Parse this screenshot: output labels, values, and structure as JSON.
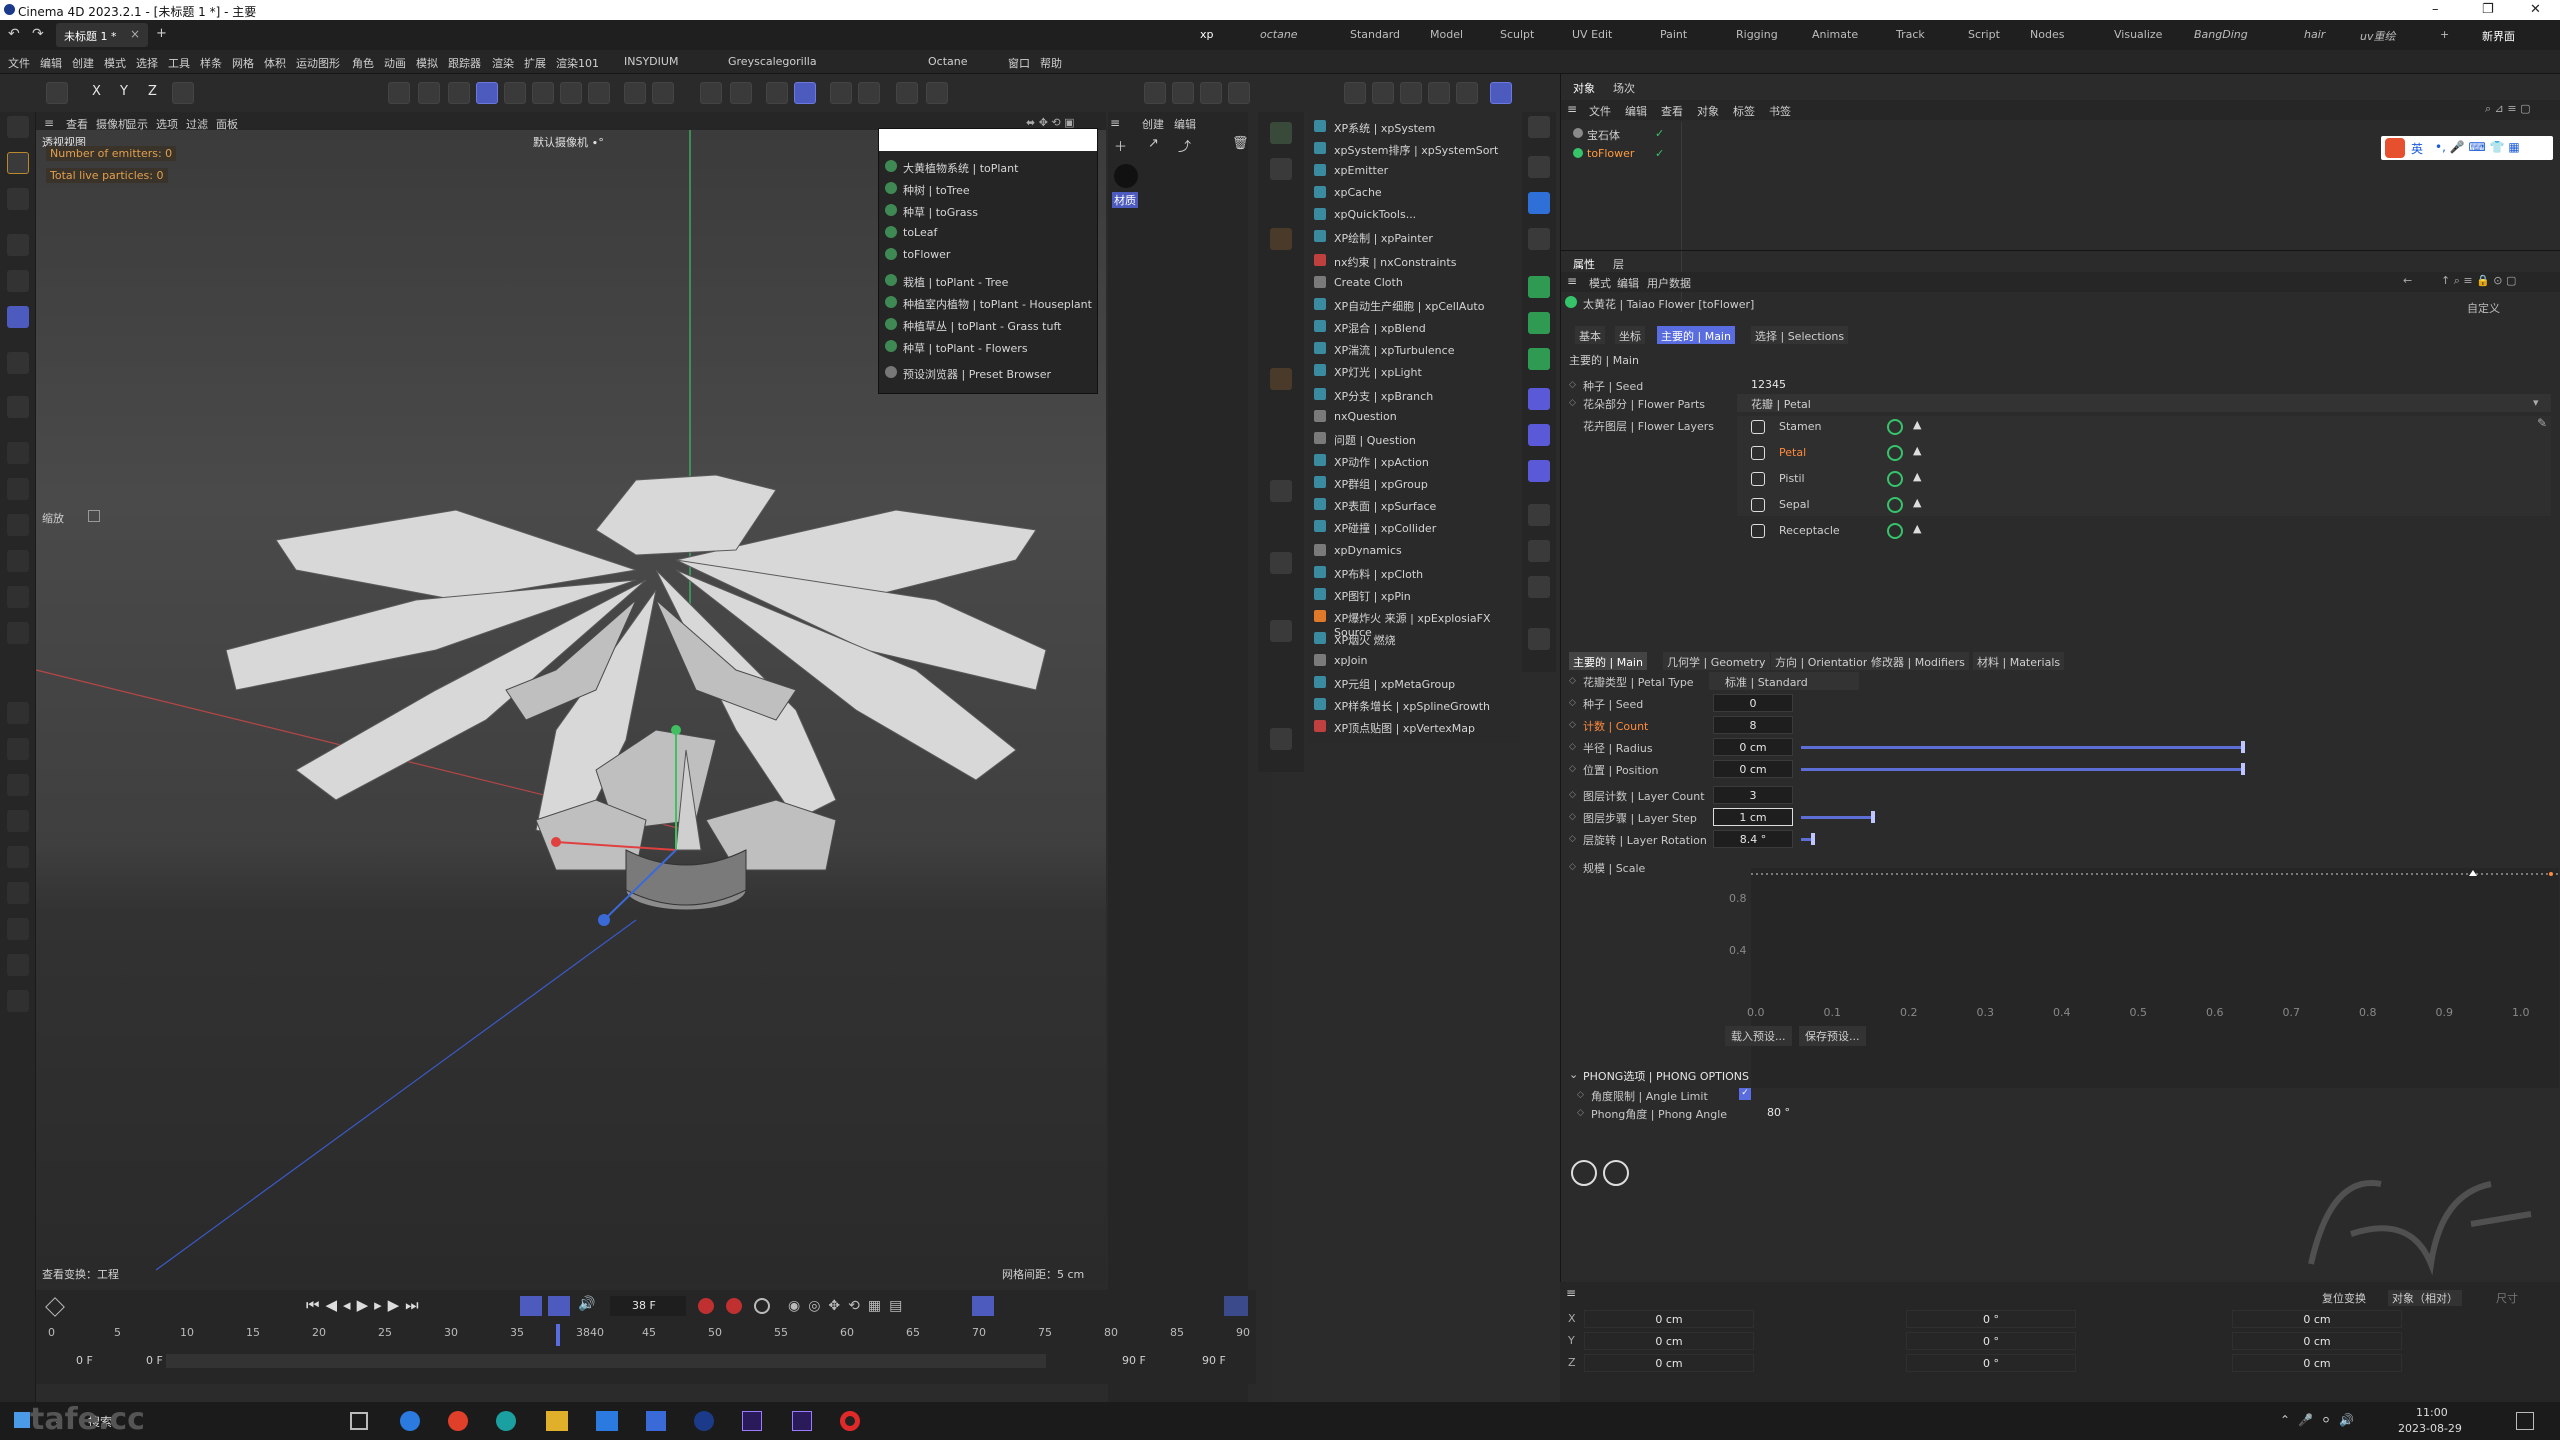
{
  "window": {
    "title": "Cinema 4D 2023.2.1 - [未标题 1 *] - 主要",
    "minimize": "–",
    "maximize": "❐",
    "close": "✕"
  },
  "tabs": {
    "doc": "未标题 1 *",
    "close": "×",
    "add": "+",
    "layouts": [
      "xp",
      "octane",
      "Standard",
      "Model",
      "Sculpt",
      "UV Edit",
      "Paint",
      "Rigging",
      "Animate",
      "Track",
      "Script",
      "Nodes",
      "Visualize",
      "BangDing",
      "hair",
      "uv重绘"
    ],
    "new_interface": "新界面"
  },
  "menus": [
    "文件",
    "编辑",
    "创建",
    "模式",
    "选择",
    "工具",
    "样条",
    "网格",
    "体积",
    "运动图形",
    "角色",
    "动画",
    "模拟",
    "跟踪器",
    "渲染",
    "扩展",
    "渲染101",
    "INSYDIUM",
    "Greyscalegorilla",
    "Octane",
    "窗口",
    "帮助"
  ],
  "toolbar": {
    "x": "X",
    "y": "Y",
    "z": "Z"
  },
  "viewport": {
    "menus": [
      "查看",
      "摄像机",
      "显示",
      "选项",
      "过滤",
      "面板"
    ],
    "label": "透视视图",
    "camera": "默认摄像机 ∙°",
    "emitters": "Number of emitters: 0",
    "particles": "Total live particles: 0",
    "zoom_label": "缩放",
    "footer_left": "查看变换：工程",
    "footer_right": "网格间距：5 cm"
  },
  "popup": {
    "items": [
      "大黄植物系统 | toPlant",
      "种树 | toTree",
      "种草 | toGrass",
      "toLeaf",
      "toFlower",
      "栽植 | toPlant - Tree",
      "种植室内植物 | toPlant - Houseplant",
      "种植草丛 | toPlant - Grass tuft",
      "种草 | toPlant - Flowers",
      "预设浏览器 | Preset Browser"
    ]
  },
  "objstrip": {
    "menus": [
      "创建",
      "编辑"
    ],
    "material": "材质"
  },
  "xplist": {
    "items": [
      "XP系统 | xpSystem",
      "xpSystem排序 | xpSystemSort",
      "xpEmitter",
      "xpCache",
      "xpQuickTools...",
      "XP绘制 | xpPainter",
      "nx约束 | nxConstraints",
      "Create Cloth",
      "XP自动生产细胞 | xpCellAuto",
      "XP混合 | xpBlend",
      "XP湍流 | xpTurbulence",
      "XP灯光 | xpLight",
      "XP分支 | xpBranch",
      "nxQuestion",
      "问题 | Question",
      "XP动作 | xpAction",
      "XP群组 | xpGroup",
      "XP表面 | xpSurface",
      "XP碰撞 | xpCollider",
      "xpDynamics",
      "XP布料 | xpCloth",
      "XP图钉 | xpPin",
      "XP爆炸火 来源 | xpExplosiaFX Source",
      "XP烟火 燃烧",
      "xpJoin",
      "XP元组 | xpMetaGroup",
      "XP样条增长 | xpSplineGrowth",
      "XP顶点贴图 | xpVertexMap"
    ]
  },
  "objects": {
    "tabs": [
      "对象",
      "场次"
    ],
    "menus": [
      "文件",
      "编辑",
      "查看",
      "对象",
      "标签",
      "书签"
    ],
    "rows": [
      {
        "name": "宝石体",
        "active": false
      },
      {
        "name": "toFlower",
        "active": true
      }
    ]
  },
  "ime": {
    "label": "英"
  },
  "attributes": {
    "tabs": [
      "属性",
      "层"
    ],
    "menus": [
      "模式",
      "编辑",
      "用户数据"
    ],
    "object": "太黄花 | Taiao Flower [toFlower]",
    "mode": "自定义",
    "subtabs": [
      "基本",
      "坐标",
      "主要的 | Main",
      "选择 | Selections"
    ],
    "section": "主要的 | Main",
    "seed_label": "种子 | Seed",
    "seed_value": "12345",
    "parts_label": "花朵部分 | Flower Parts",
    "parts_value": "花瓣 | Petal",
    "layers_label": "花卉图层 | Flower Layers",
    "layers": [
      {
        "name": "Stamen",
        "sel": false
      },
      {
        "name": "Petal",
        "sel": true
      },
      {
        "name": "Pistil",
        "sel": false
      },
      {
        "name": "Sepal",
        "sel": false
      },
      {
        "name": "Receptacle",
        "sel": false
      }
    ],
    "petal_tabs": [
      "主要的 | Main",
      "几何学 | Geometry",
      "方向 | Orientation",
      "修改器 | Modifiers",
      "材料 | Materials"
    ],
    "petal_type_label": "花瓣类型 | Petal Type",
    "petal_type_value": "标准 | Standard",
    "seed2_label": "种子 | Seed",
    "seed2_value": "0",
    "count_label": "计数 | Count",
    "count_value": "8",
    "radius_label": "半径 | Radius",
    "radius_value": "0 cm",
    "position_label": "位置 | Position",
    "position_value": "0 cm",
    "layer_count_label": "图层计数 | Layer Count",
    "layer_count_value": "3",
    "layer_step_label": "图层步骤 | Layer Step",
    "layer_step_value": "1 cm",
    "layer_rot_label": "层旋转 | Layer Rotation",
    "layer_rot_value": "8.4 °",
    "scale_label": "规模 | Scale",
    "curve_y": [
      "0.8",
      "0.4"
    ],
    "curve_x": [
      "0.0",
      "0.1",
      "0.2",
      "0.3",
      "0.4",
      "0.5",
      "0.6",
      "0.7",
      "0.8",
      "0.9",
      "1.0"
    ],
    "load_preset": "载入预设...",
    "save_preset": "保存预设...",
    "phong_header": "PHONG选项 | PHONG OPTIONS",
    "angle_limit_label": "角度限制 | Angle Limit",
    "phong_angle_label": "Phong角度 | Phong Angle",
    "phong_angle_value": "80 °"
  },
  "coords": {
    "reset": "复位变换",
    "mode": "对象（相对）",
    "size": "尺寸",
    "rows": [
      {
        "axis": "X",
        "pos": "0 cm",
        "rot": "0 °",
        "scale": "0 cm"
      },
      {
        "axis": "Y",
        "pos": "0 cm",
        "rot": "0 °",
        "scale": "0 cm"
      },
      {
        "axis": "Z",
        "pos": "0 cm",
        "rot": "0 °",
        "scale": "0 cm"
      }
    ]
  },
  "timeline": {
    "frame": "38 F",
    "ticks": [
      "0",
      "5",
      "10",
      "15",
      "20",
      "25",
      "30",
      "35",
      "3840",
      "45",
      "50",
      "55",
      "60",
      "65",
      "70",
      "75",
      "80",
      "85",
      "90"
    ],
    "start": "0 F",
    "start2": "0 F",
    "end": "90 F",
    "end2": "90 F"
  },
  "taskbar": {
    "search": "搜索",
    "time": "11:00",
    "date": "2023-08-29"
  },
  "watermark": "tafe.cc",
  "colors": {
    "accent": "#5a6de0",
    "orange": "#ff8a3d",
    "green": "#36c46a"
  }
}
